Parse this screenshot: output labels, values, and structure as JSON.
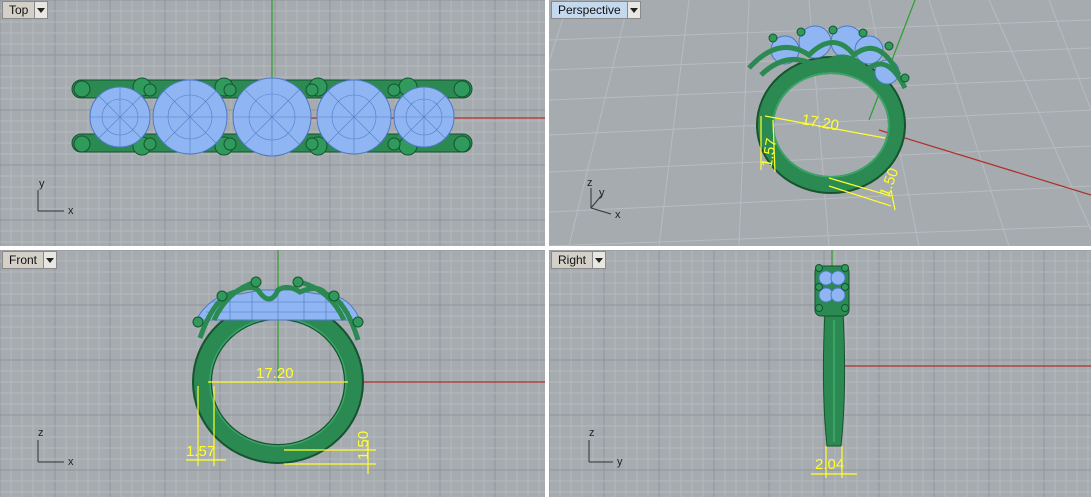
{
  "viewports": {
    "top": {
      "label": "Top",
      "axes": [
        "y",
        "x"
      ]
    },
    "perspective": {
      "label": "Perspective",
      "axes": [
        "z",
        "y",
        "x"
      ]
    },
    "front": {
      "label": "Front",
      "axes": [
        "z",
        "x"
      ]
    },
    "right": {
      "label": "Right",
      "axes": [
        "z",
        "y"
      ]
    }
  },
  "dimensions": {
    "inner_diameter": "17.20",
    "band_thickness": "1.57",
    "band_height": "1.50",
    "band_width": "2.04"
  },
  "colors": {
    "viewport_bg": "#a6abb0",
    "grid_minor": "#b3b8bd",
    "grid_major": "#8f959b",
    "x_axis": "#b0302c",
    "y_axis": "#2ca02c",
    "metal": "#2a8a52",
    "gem_wire": "#8fb6f2",
    "dimension": "#ffff2a",
    "active_tab": "#c4d8ee"
  }
}
